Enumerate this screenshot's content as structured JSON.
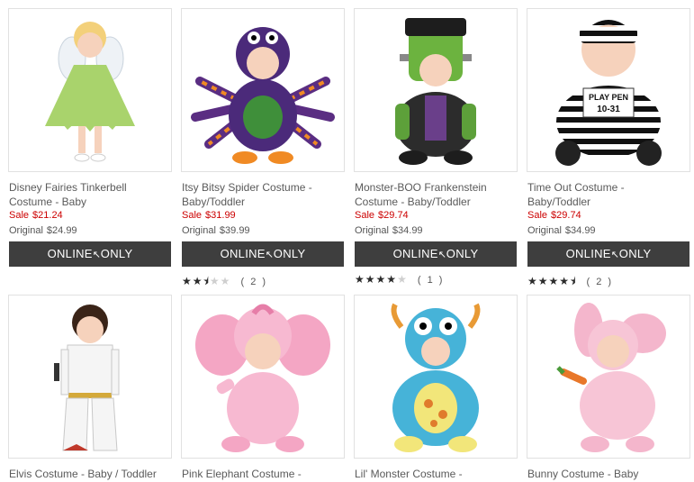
{
  "products": [
    {
      "title": "Disney Fairies Tinkerbell Costume - Baby",
      "sale_label": "Sale",
      "sale_price": "$21.24",
      "orig_label": "Original",
      "orig_price": "$24.99",
      "badge_left": "ONLINE",
      "badge_right": "ONLY",
      "rating": null,
      "review_count": ""
    },
    {
      "title": "Itsy Bitsy Spider Costume - Baby/Toddler",
      "sale_label": "Sale",
      "sale_price": "$31.99",
      "orig_label": "Original",
      "orig_price": "$39.99",
      "badge_left": "ONLINE",
      "badge_right": "ONLY",
      "rating": 2.5,
      "review_count": "( 2 )"
    },
    {
      "title": "Monster-BOO Frankenstein Costume - Baby/Toddler",
      "sale_label": "Sale",
      "sale_price": "$29.74",
      "orig_label": "Original",
      "orig_price": "$34.99",
      "badge_left": "ONLINE",
      "badge_right": "ONLY",
      "rating": 4,
      "review_count": "( 1 )"
    },
    {
      "title": "Time Out Costume - Baby/Toddler",
      "sale_label": "Sale",
      "sale_price": "$29.74",
      "orig_label": "Original",
      "orig_price": "$34.99",
      "badge_left": "ONLINE",
      "badge_right": "ONLY",
      "rating": 4.5,
      "review_count": "( 2 )"
    },
    {
      "title": "Elvis Costume - Baby / Toddler"
    },
    {
      "title": "Pink Elephant Costume -"
    },
    {
      "title": "Lil' Monster Costume -"
    },
    {
      "title": "Bunny Costume - Baby"
    }
  ],
  "stamp_text": [
    "PLAY PEN",
    "10-31"
  ],
  "colors": {
    "sale": "#cc0000",
    "badge_bg": "#3e3e3e",
    "text": "#5a5a5a"
  }
}
